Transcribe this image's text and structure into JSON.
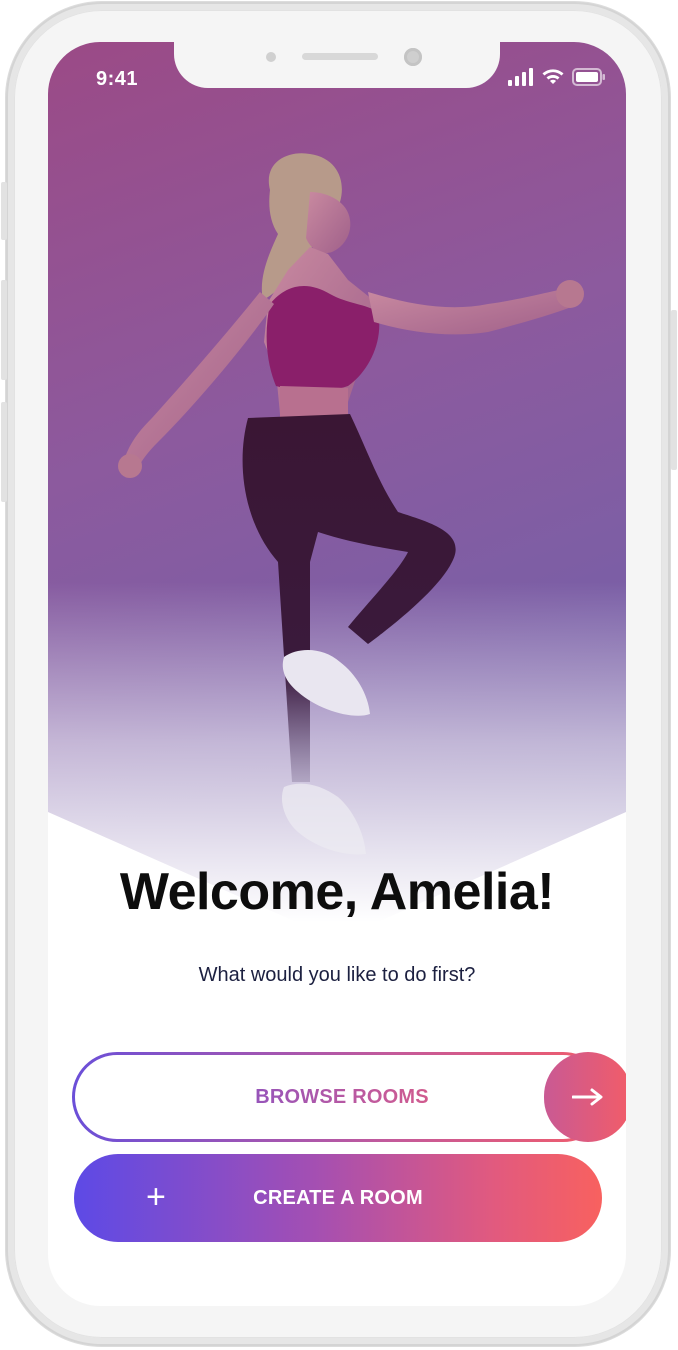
{
  "status_bar": {
    "time": "9:41"
  },
  "welcome": {
    "title": "Welcome, Amelia!",
    "subtitle": "What would you like to do first?"
  },
  "actions": {
    "browse_label": "BROWSE ROOMS",
    "create_label": "CREATE A ROOM",
    "create_icon": "+"
  },
  "colors": {
    "gradient_start": "#5d4ae6",
    "gradient_mid": "#a34fb3",
    "gradient_end": "#f8615f",
    "hero_tint": "#8c5a9e",
    "title_text": "#0d0d0d",
    "subtitle_text": "#1c2040"
  },
  "icons": {
    "signal": "signal-icon",
    "wifi": "wifi-icon",
    "battery": "battery-icon",
    "arrow": "arrow-right-icon",
    "plus": "plus-icon",
    "hero": "hero-photo"
  }
}
